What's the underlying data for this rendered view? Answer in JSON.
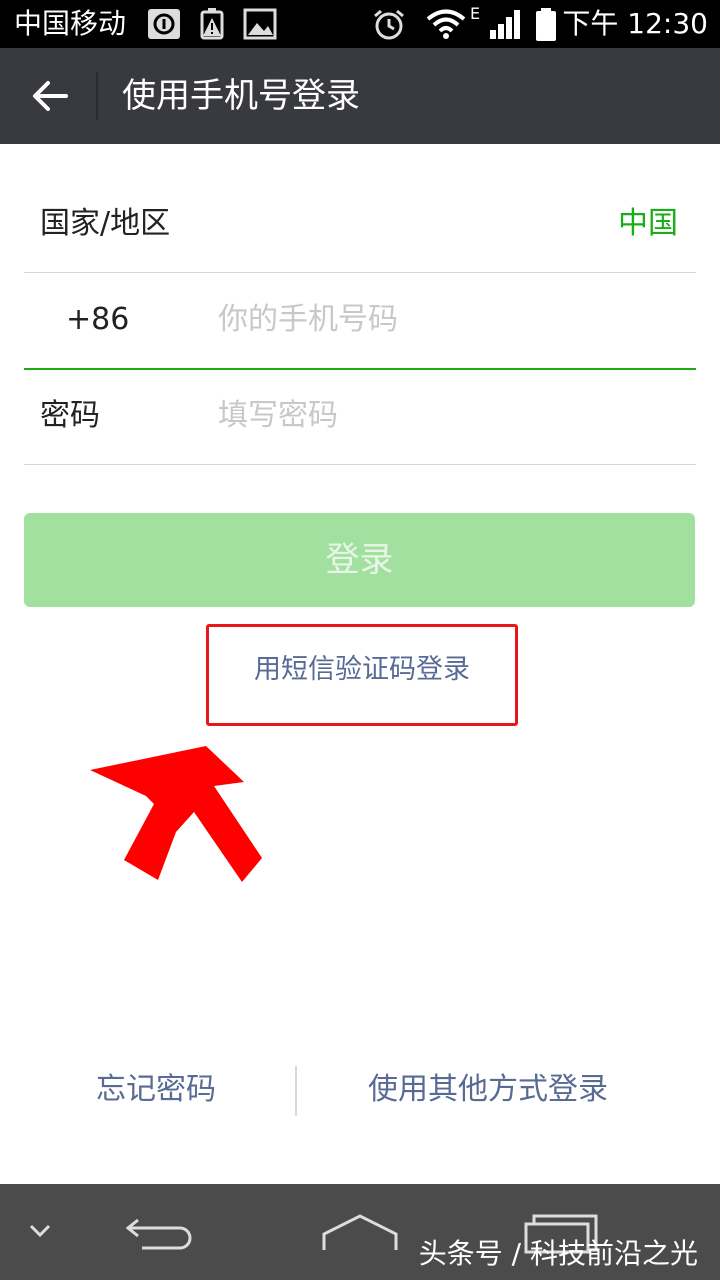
{
  "status_bar": {
    "carrier": "中国移动",
    "network": "E",
    "time": "下午 12:30"
  },
  "header": {
    "title": "使用手机号登录",
    "back_icon": "arrow-left-icon"
  },
  "form": {
    "country_label": "国家/地区",
    "country_value": "中国",
    "country_code": "+86",
    "phone_placeholder": "你的手机号码",
    "password_label": "密码",
    "password_placeholder": "填写密码"
  },
  "login_button": "登录",
  "sms_login_link": "用短信验证码登录",
  "bottom_links": {
    "forgot_password": "忘记密码",
    "other_methods": "使用其他方式登录"
  },
  "watermark": "头条号 / 科技前沿之光",
  "colors": {
    "accent_green": "#1aad19",
    "login_button_disabled": "#a2e0a0",
    "link_blue": "#576b95",
    "title_bar": "#393a3f",
    "annotation_red": "#e81818"
  }
}
